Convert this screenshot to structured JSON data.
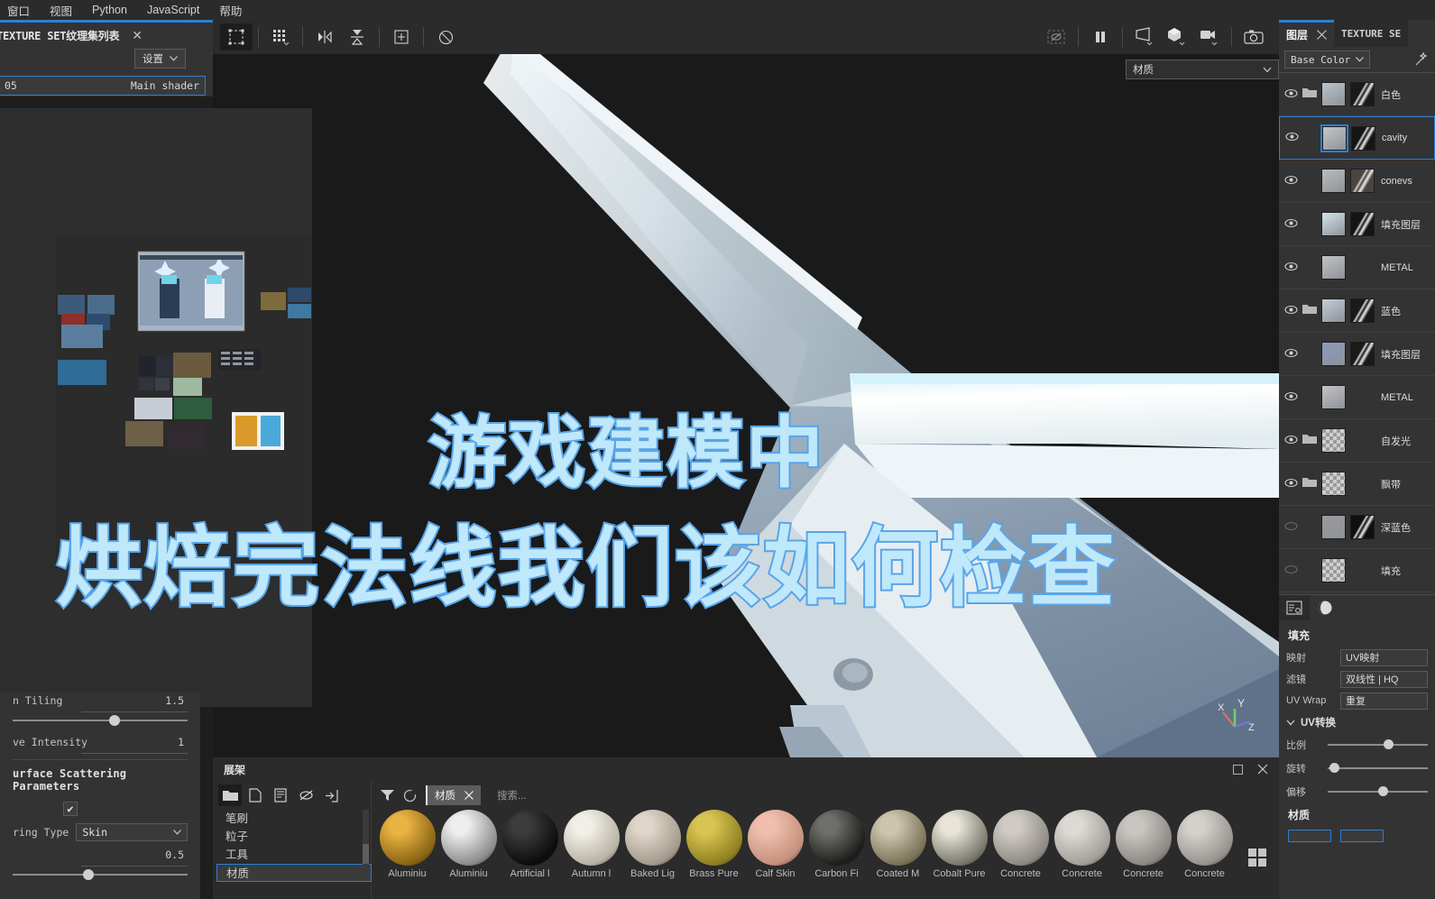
{
  "menubar": {
    "items": [
      "窗口",
      "视图",
      "Python",
      "JavaScript",
      "帮助"
    ]
  },
  "texture_set_panel": {
    "tab_label": "TEXTURE SET纹理集列表",
    "close_icon": "close-icon",
    "settings_label": "设置",
    "shader_row": {
      "name": "05",
      "shader": "Main shader"
    }
  },
  "toolbar": {
    "left_tools": [
      {
        "name": "selection-tool",
        "glyph": "select"
      },
      {
        "name": "uv-grid-tool",
        "glyph": "grid"
      },
      {
        "name": "symmetry-tool",
        "glyph": "symmetry"
      },
      {
        "name": "projection-tool",
        "glyph": "projection"
      },
      {
        "name": "add-tool",
        "glyph": "plus-box"
      },
      {
        "name": "reset-tool",
        "glyph": "reset"
      }
    ],
    "right_tools": [
      {
        "name": "hide-mask-icon",
        "glyph": "masked-eye"
      },
      {
        "name": "pause-icon",
        "glyph": "pause"
      },
      {
        "name": "camera-shape-icon",
        "glyph": "frustum"
      },
      {
        "name": "cube-icon",
        "glyph": "cube"
      },
      {
        "name": "video-camera-icon",
        "glyph": "video"
      },
      {
        "name": "screenshot-icon",
        "glyph": "photo"
      }
    ]
  },
  "viewport": {
    "material_select": "材质",
    "gizmo_axes": [
      "X",
      "Y",
      "Z"
    ]
  },
  "overlay": {
    "line1": "游戏建模中",
    "line2": "烘焙完法线我们该如何检查",
    "fill_color": "#bfe8fb",
    "stroke_color": "#59a5e8"
  },
  "shelf": {
    "title": "展架",
    "maximize_icon": "maximize-icon",
    "close_icon": "close-icon",
    "toolbar_icons": [
      {
        "name": "folder-icon"
      },
      {
        "name": "new-file-icon"
      },
      {
        "name": "save-icon"
      },
      {
        "name": "hide-icon"
      },
      {
        "name": "import-icon"
      }
    ],
    "categories": [
      "笔刷",
      "粒子",
      "工具",
      "材质"
    ],
    "selected_category": "材质",
    "filter_icon": "filter-icon",
    "refresh_icon": "refresh-icon",
    "chip_label": "材质",
    "chip_close": "close-icon",
    "search_placeholder": "搜索...",
    "grid_toggle_icon": "grid-view-icon",
    "materials": [
      {
        "name": "Aluminiu",
        "color1": "#e9b442",
        "color2": "#8a6413"
      },
      {
        "name": "Aluminiu",
        "color1": "#eeeeee",
        "color2": "#8c8c8c"
      },
      {
        "name": "Artificial l",
        "color1": "#3c3c3c",
        "color2": "#0c0c0c"
      },
      {
        "name": "Autumn l",
        "color1": "#f2efe8",
        "color2": "#b8b2a4"
      },
      {
        "name": "Baked Lig",
        "color1": "#ded6c9",
        "color2": "#a49a8b"
      },
      {
        "name": "Brass Pure",
        "color1": "#d8c552",
        "color2": "#8f8020"
      },
      {
        "name": "Calf Skin",
        "color1": "#f0bfae",
        "color2": "#c58f7c"
      },
      {
        "name": "Carbon Fi",
        "color1": "#6e6e6a",
        "color2": "#1d1d1b"
      },
      {
        "name": "Coated M",
        "color1": "#cdc6ad",
        "color2": "#7a7358"
      },
      {
        "name": "Cobalt Pure",
        "color1": "#e8e4d8",
        "color2": "#7a776c"
      },
      {
        "name": "Concrete",
        "color1": "#cfcbc4",
        "color2": "#8e8a83"
      },
      {
        "name": "Concrete",
        "color1": "#dddad5",
        "color2": "#a29e98"
      },
      {
        "name": "Concrete",
        "color1": "#c9c6c1",
        "color2": "#8b8884"
      },
      {
        "name": "Concrete",
        "color1": "#d4d1cb",
        "color2": "#97948f"
      }
    ]
  },
  "left_props": {
    "row_truncated_label": "n Tiling",
    "row_truncated_value": "1.5",
    "emissive_label": "ve Intensity",
    "emissive_value": "1",
    "section_title": "urface Scattering Parameters",
    "enable_checkmark": "✔",
    "scattering_type_label": "ring Type",
    "scattering_type_value": "Skin",
    "scattering_amount": "0.5"
  },
  "layers_panel": {
    "tabs": [
      {
        "label": "图层",
        "selected": true,
        "close_icon": "close-icon"
      },
      {
        "label": "TEXTURE SE",
        "selected": false
      }
    ],
    "channel_select": "Base Color",
    "magic_icon": "magic-wand-icon",
    "layers": [
      {
        "name": "白色",
        "type": "folder",
        "visible": true,
        "selected": false,
        "thumb": "#b9c4c8",
        "mask": "#1a1a1a",
        "bar": "gray",
        "maskbar": "gray",
        "has_mask": true
      },
      {
        "name": "cavity",
        "type": "layer",
        "visible": true,
        "selected": true,
        "thumb": "#c6c6c6",
        "mask": "#151515",
        "bar": "gray",
        "maskbar": "orange",
        "has_mask": true
      },
      {
        "name": "conevs",
        "type": "layer",
        "visible": true,
        "selected": false,
        "thumb": "#bcbcbc",
        "mask": "#4a4540",
        "bar": "gray",
        "maskbar": "orange",
        "has_mask": true
      },
      {
        "name": "填充图层",
        "type": "layer",
        "visible": true,
        "selected": false,
        "thumb": "#d3e3ee",
        "mask": "#151515",
        "bar": "gray",
        "maskbar": "gray",
        "has_mask": true
      },
      {
        "name": "METAL",
        "type": "layer",
        "visible": true,
        "selected": false,
        "thumb": "#c3c3c3",
        "mask": null,
        "bar": "gray",
        "maskbar": null,
        "has_mask": false
      },
      {
        "name": "蓝色",
        "type": "folder",
        "visible": true,
        "selected": false,
        "thumb": "#c2ccd6",
        "mask": "#1a1a1a",
        "bar": "gray",
        "maskbar": "gray",
        "has_mask": true
      },
      {
        "name": "填充图层",
        "type": "layer",
        "visible": true,
        "selected": false,
        "thumb": "#8a9ac0",
        "mask": "#1a1a1a",
        "bar": "gray",
        "maskbar": "gray",
        "has_mask": true
      },
      {
        "name": "METAL",
        "type": "layer",
        "visible": true,
        "selected": false,
        "thumb": "#c3c3c3",
        "mask": null,
        "bar": "gray",
        "maskbar": null,
        "has_mask": false
      },
      {
        "name": "自发光",
        "type": "folder",
        "visible": true,
        "selected": false,
        "thumb": "checker",
        "mask": null,
        "bar": "gray",
        "maskbar": null,
        "has_mask": false
      },
      {
        "name": "飘带",
        "type": "folder",
        "visible": true,
        "selected": false,
        "thumb": "checker",
        "mask": null,
        "bar": "gray",
        "maskbar": null,
        "has_mask": false
      },
      {
        "name": "深蓝色",
        "type": "layer",
        "visible": false,
        "selected": false,
        "thumb": "#9a9a9a",
        "mask": "#101010",
        "bar": "gray",
        "maskbar": "gray",
        "has_mask": true
      },
      {
        "name": "填充",
        "type": "layer",
        "visible": false,
        "selected": false,
        "thumb": "checker",
        "mask": null,
        "bar": "gray",
        "maskbar": null,
        "has_mask": false
      }
    ],
    "properties": {
      "tab_settings_icon": "settings-sliders-icon",
      "tab_material_icon": "sphere-icon",
      "title": "填充",
      "rows": [
        {
          "key": "映射",
          "value": "UV映射"
        },
        {
          "key": "滤镜",
          "value": "双线性 | HQ"
        },
        {
          "key": "UV Wrap",
          "value": "重复"
        }
      ],
      "uv_transform_label": "UV转换",
      "uv_transform_expanded": true,
      "sliders": [
        {
          "key": "比例",
          "pos": 56
        },
        {
          "key": "旋转",
          "pos": 2
        },
        {
          "key": "偏移",
          "pos": 50
        }
      ],
      "material_title": "材质"
    }
  }
}
